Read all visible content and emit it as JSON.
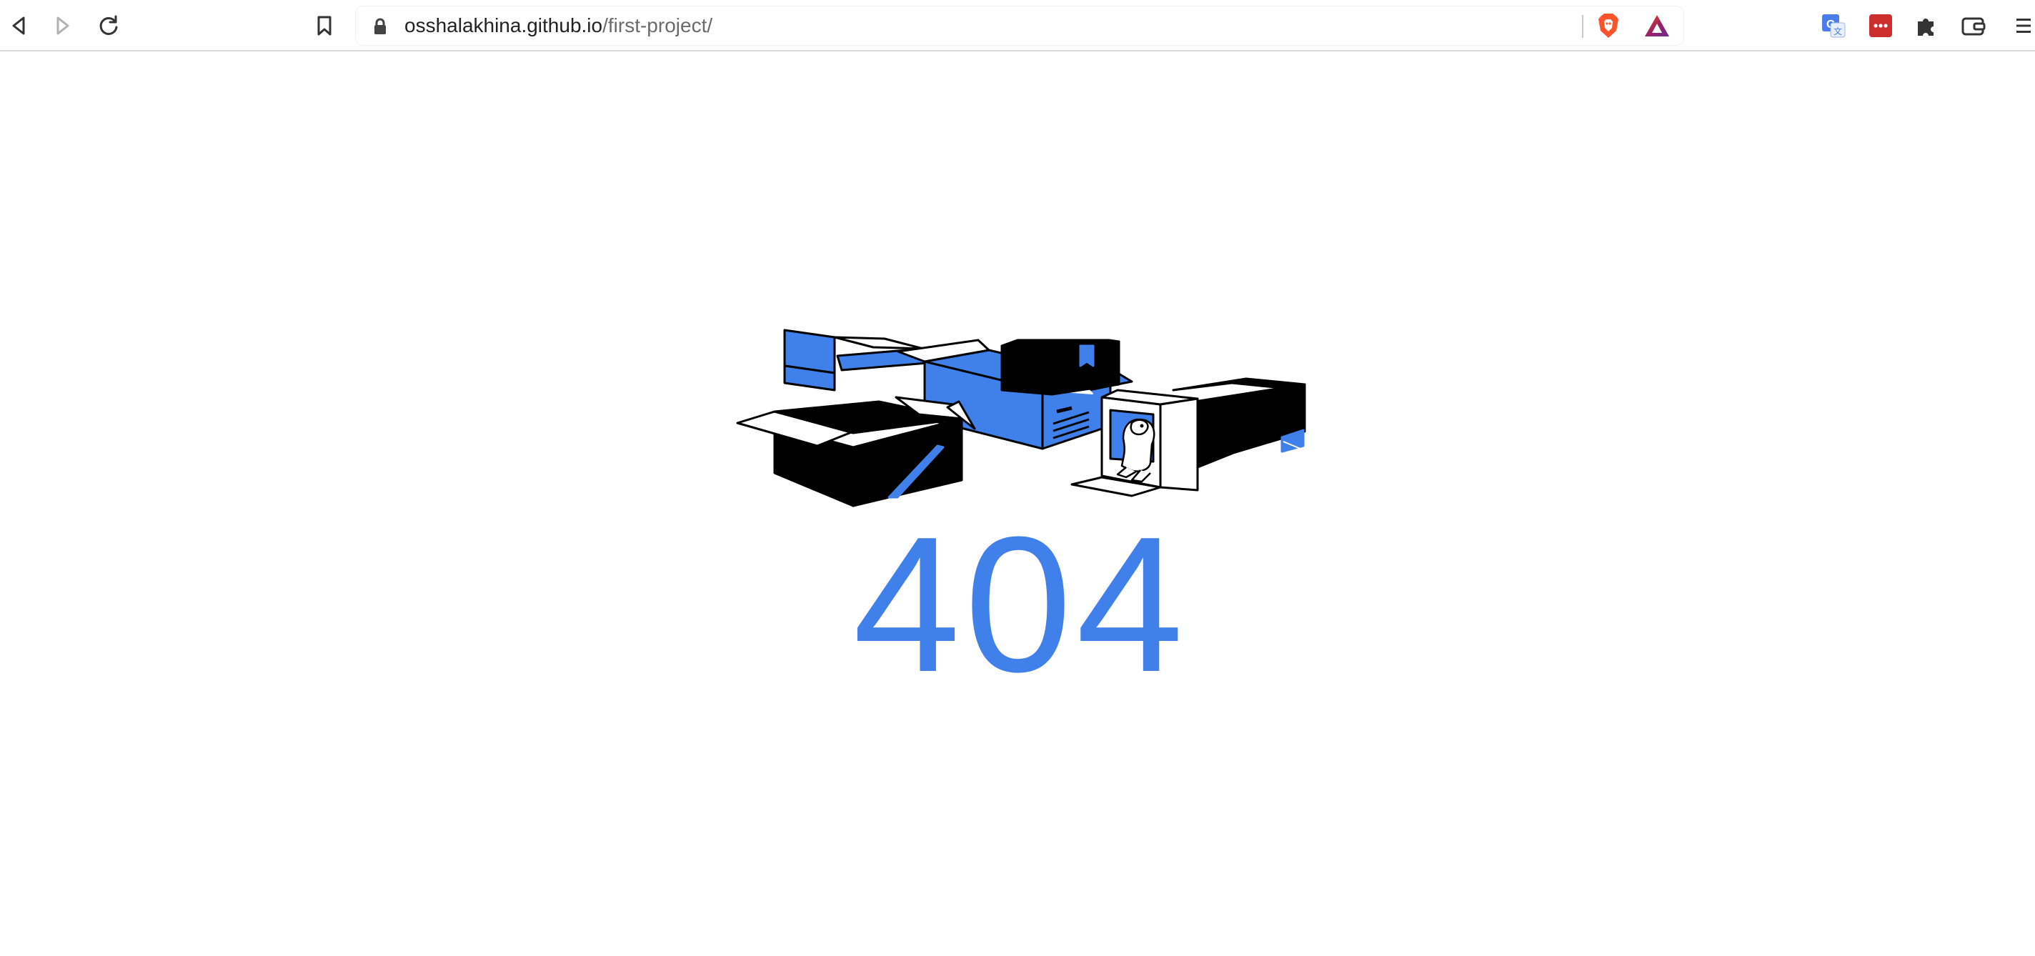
{
  "browser": {
    "url_host": "osshalakhina.github.io",
    "url_path": "/first-project/",
    "icons": {
      "back": "back-arrow-icon",
      "forward": "forward-arrow-icon",
      "reload": "reload-icon",
      "bookmark": "bookmark-icon",
      "lock": "lock-icon",
      "brave_shields": "brave-shield-icon",
      "rewards": "brave-rewards-icon",
      "translate": "translate-icon",
      "password_manager": "password-manager-icon",
      "extensions": "puzzle-icon",
      "wallet": "wallet-icon",
      "menu": "menu-icon"
    }
  },
  "page": {
    "error_code": "404"
  },
  "colors": {
    "accent": "#3f80ea",
    "ink": "#000000",
    "background": "#ffffff"
  }
}
